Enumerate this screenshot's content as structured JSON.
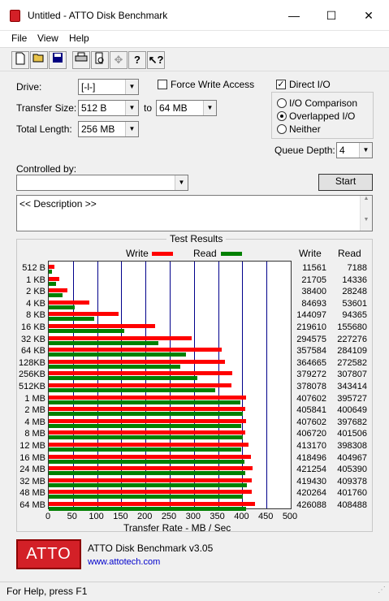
{
  "window": {
    "title": "Untitled - ATTO Disk Benchmark",
    "min": "—",
    "max": "☐",
    "close": "✕"
  },
  "menu": [
    "File",
    "View",
    "Help"
  ],
  "toolbar": {
    "icons": [
      "new-icon",
      "open-icon",
      "save-icon",
      "print-icon",
      "print-preview-icon",
      "move-icon",
      "help-icon",
      "context-help-icon"
    ]
  },
  "form": {
    "drive_label": "Drive:",
    "drive_value": "[-l-]",
    "transfer_size_label": "Transfer Size:",
    "transfer_from": "512 B",
    "to_label": "to",
    "transfer_to": "64 MB",
    "total_length_label": "Total Length:",
    "total_length": "256 MB",
    "force_write_label": "Force Write Access",
    "force_write_checked": false,
    "direct_io_label": "Direct I/O",
    "direct_io_checked": true,
    "io_comparison_label": "I/O Comparison",
    "overlapped_io_label": "Overlapped I/O",
    "neither_label": "Neither",
    "io_mode": "overlapped",
    "queue_depth_label": "Queue Depth:",
    "queue_depth": "4",
    "controlled_by_label": "Controlled by:",
    "controlled_by_value": "",
    "start_label": "Start",
    "description": "<< Description >>"
  },
  "results": {
    "title": "Test Results",
    "legend_write": "Write",
    "legend_read": "Read",
    "col_write": "Write",
    "col_read": "Read",
    "xlabel": "Transfer Rate - MB / Sec"
  },
  "chart_data": {
    "type": "bar",
    "orientation": "horizontal",
    "categories": [
      "512 B",
      "1 KB",
      "2 KB",
      "4 KB",
      "8 KB",
      "16 KB",
      "32 KB",
      "64 KB",
      "128KB",
      "256KB",
      "512KB",
      "1 MB",
      "2 MB",
      "4 MB",
      "8 MB",
      "12 MB",
      "16 MB",
      "24 MB",
      "32 MB",
      "48 MB",
      "64 MB"
    ],
    "series": [
      {
        "name": "Write",
        "color": "#ff0000",
        "values": [
          11561,
          21705,
          38400,
          84693,
          144097,
          219610,
          294575,
          357584,
          364665,
          379272,
          378078,
          407602,
          405841,
          407602,
          406720,
          413170,
          418496,
          421254,
          419430,
          420264,
          426088
        ]
      },
      {
        "name": "Read",
        "color": "#008000",
        "values": [
          7188,
          14336,
          28248,
          53601,
          94365,
          155680,
          227276,
          284109,
          272582,
          307807,
          343414,
          395727,
          400649,
          397682,
          401506,
          398308,
          404967,
          405390,
          409378,
          401760,
          408488
        ]
      }
    ],
    "value_unit_divisor": 1000,
    "xlim": [
      0,
      500
    ],
    "xticks": [
      "0",
      "50",
      "100",
      "150",
      "200",
      "250",
      "300",
      "350",
      "400",
      "450",
      "500"
    ],
    "xlabel": "Transfer Rate - MB / Sec",
    "grid": true,
    "legend": "top"
  },
  "footer": {
    "logo": "ATTO",
    "app_name": "ATTO Disk Benchmark v3.05",
    "url": "www.attotech.com"
  },
  "status": {
    "text": "For Help, press F1"
  },
  "colors": {
    "write": "#ff0000",
    "read": "#008000",
    "grid": "#00008b",
    "logo": "#d32027"
  }
}
